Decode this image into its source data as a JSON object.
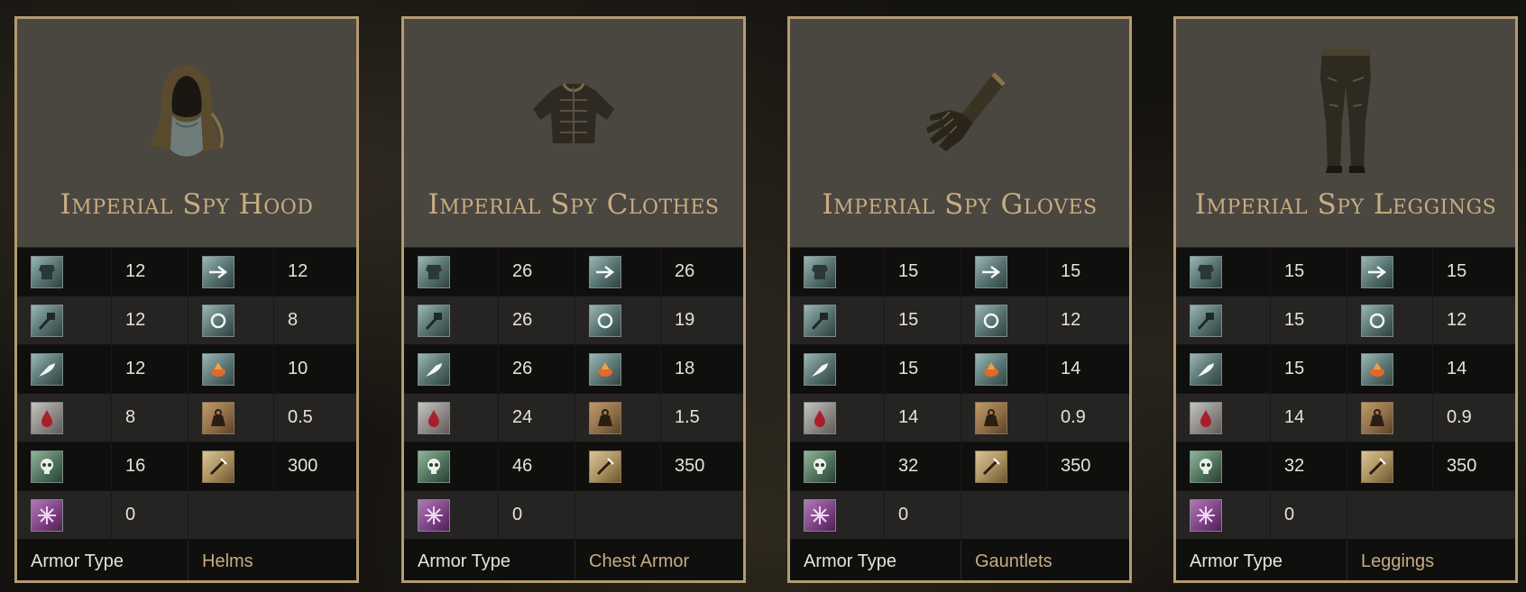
{
  "cards": [
    {
      "title": "Imperial Spy Hood",
      "image_icon": "hood-icon",
      "stats": [
        {
          "left_icon": "physical-armor-icon",
          "left_value": "12",
          "right_icon": "pierce-armor-icon",
          "right_value": "12"
        },
        {
          "left_icon": "strike-armor-icon",
          "left_value": "12",
          "right_icon": "magic-armor-icon",
          "right_value": "8"
        },
        {
          "left_icon": "slash-armor-icon",
          "left_value": "12",
          "right_icon": "fire-armor-icon",
          "right_value": "10"
        },
        {
          "left_icon": "bleed-resistance-icon",
          "left_value": "8",
          "right_icon": "weight-icon",
          "right_value": "0.5"
        },
        {
          "left_icon": "poison-resistance-icon",
          "left_value": "16",
          "right_icon": "durability-icon",
          "right_value": "300"
        },
        {
          "left_icon": "frost-resistance-icon",
          "left_value": "0"
        }
      ],
      "armor_type_label": "Armor Type",
      "armor_type_value": "Helms"
    },
    {
      "title": "Imperial Spy Clothes",
      "image_icon": "chest-armor-icon",
      "stats": [
        {
          "left_icon": "physical-armor-icon",
          "left_value": "26",
          "right_icon": "pierce-armor-icon",
          "right_value": "26"
        },
        {
          "left_icon": "strike-armor-icon",
          "left_value": "26",
          "right_icon": "magic-armor-icon",
          "right_value": "19"
        },
        {
          "left_icon": "slash-armor-icon",
          "left_value": "26",
          "right_icon": "fire-armor-icon",
          "right_value": "18"
        },
        {
          "left_icon": "bleed-resistance-icon",
          "left_value": "24",
          "right_icon": "weight-icon",
          "right_value": "1.5"
        },
        {
          "left_icon": "poison-resistance-icon",
          "left_value": "46",
          "right_icon": "durability-icon",
          "right_value": "350"
        },
        {
          "left_icon": "frost-resistance-icon",
          "left_value": "0"
        }
      ],
      "armor_type_label": "Armor Type",
      "armor_type_value": "Chest Armor"
    },
    {
      "title": "Imperial Spy Gloves",
      "image_icon": "gauntlet-icon",
      "stats": [
        {
          "left_icon": "physical-armor-icon",
          "left_value": "15",
          "right_icon": "pierce-armor-icon",
          "right_value": "15"
        },
        {
          "left_icon": "strike-armor-icon",
          "left_value": "15",
          "right_icon": "magic-armor-icon",
          "right_value": "12"
        },
        {
          "left_icon": "slash-armor-icon",
          "left_value": "15",
          "right_icon": "fire-armor-icon",
          "right_value": "14"
        },
        {
          "left_icon": "bleed-resistance-icon",
          "left_value": "14",
          "right_icon": "weight-icon",
          "right_value": "0.9"
        },
        {
          "left_icon": "poison-resistance-icon",
          "left_value": "32",
          "right_icon": "durability-icon",
          "right_value": "350"
        },
        {
          "left_icon": "frost-resistance-icon",
          "left_value": "0"
        }
      ],
      "armor_type_label": "Armor Type",
      "armor_type_value": "Gauntlets"
    },
    {
      "title": "Imperial Spy Leggings",
      "image_icon": "leggings-icon",
      "stats": [
        {
          "left_icon": "physical-armor-icon",
          "left_value": "15",
          "right_icon": "pierce-armor-icon",
          "right_value": "15"
        },
        {
          "left_icon": "strike-armor-icon",
          "left_value": "15",
          "right_icon": "magic-armor-icon",
          "right_value": "12"
        },
        {
          "left_icon": "slash-armor-icon",
          "left_value": "15",
          "right_icon": "fire-armor-icon",
          "right_value": "14"
        },
        {
          "left_icon": "bleed-resistance-icon",
          "left_value": "14",
          "right_icon": "weight-icon",
          "right_value": "0.9"
        },
        {
          "left_icon": "poison-resistance-icon",
          "left_value": "32",
          "right_icon": "durability-icon",
          "right_value": "350"
        },
        {
          "left_icon": "frost-resistance-icon",
          "left_value": "0"
        }
      ],
      "armor_type_label": "Armor Type",
      "armor_type_value": "Leggings"
    }
  ],
  "colors": {
    "border_gold": "#b39b72",
    "title_gold": "#c8ac80",
    "header_bg": "#4a4640"
  }
}
